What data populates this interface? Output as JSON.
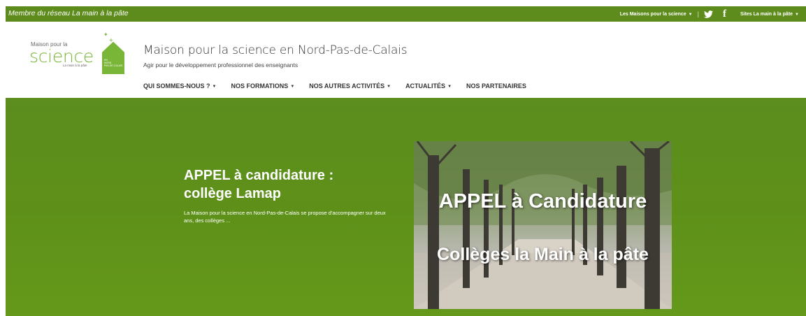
{
  "topbar": {
    "network_label": "Membre du réseau La main à la pâte",
    "maisons_label": "Les Maisons pour la science",
    "separator": "|",
    "sites_label": "Sites La main à la pâte",
    "twitter_icon": "twitter-icon",
    "facebook_icon": "facebook-icon",
    "facebook_glyph": "f",
    "caret": "▼"
  },
  "logo": {
    "line1": "Maison pour la",
    "line2": "science",
    "line3": "La main à la pâte",
    "house_line1": "EN",
    "house_line2": "NORD",
    "house_line3": "PAS-DE-CALAIS"
  },
  "site": {
    "title": "Maison pour la science en Nord-Pas-de-Calais",
    "subtitle": "Agir pour le développement professionnel des enseignants"
  },
  "nav": {
    "items": [
      {
        "label": "QUI SOMMES-NOUS ?",
        "has_dropdown": true
      },
      {
        "label": "NOS FORMATIONS",
        "has_dropdown": true
      },
      {
        "label": "NOS AUTRES ACTIVITÉS",
        "has_dropdown": true
      },
      {
        "label": "ACTUALITÉS",
        "has_dropdown": true
      },
      {
        "label": "NOS PARTENAIRES",
        "has_dropdown": false
      }
    ],
    "caret": "▼"
  },
  "hero": {
    "title_line1": "APPEL à candidature :",
    "title_line2": "collège Lamap",
    "text": "La Maison pour la science en Nord-Pas-de-Calais se propose d'accompagner sur deux ans, des collèges ...",
    "image_line1": "APPEL à Candidature",
    "image_line2": "Collèges la Main à la pâte"
  },
  "colors": {
    "brand_green": "#5d8c1d",
    "logo_green": "#79b536"
  }
}
